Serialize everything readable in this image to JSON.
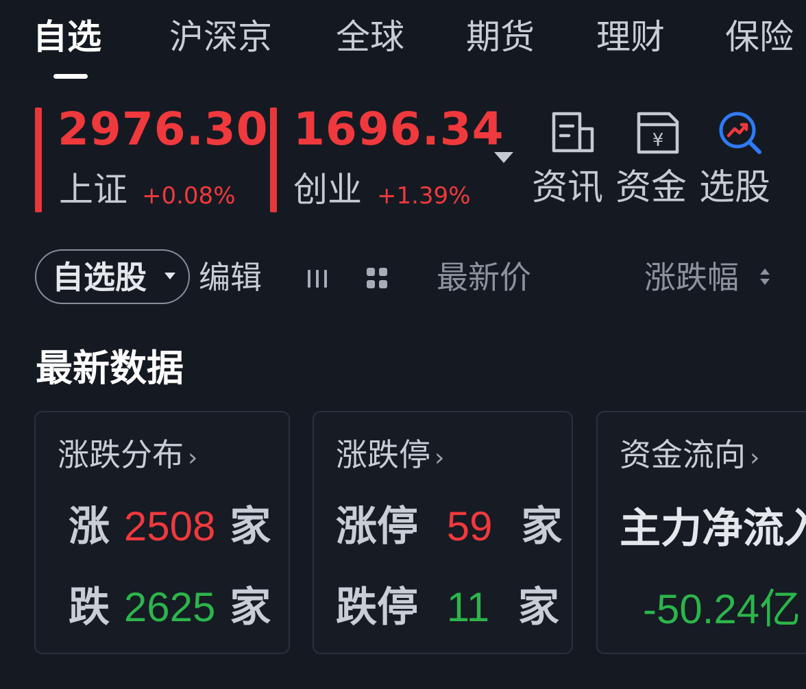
{
  "tabs": [
    {
      "label": "自选",
      "active": true
    },
    {
      "label": "沪深京"
    },
    {
      "label": "全球"
    },
    {
      "label": "期货"
    },
    {
      "label": "理财"
    },
    {
      "label": "保险"
    }
  ],
  "indices": [
    {
      "name": "上证",
      "value": "2976.30",
      "change": "+0.08%"
    },
    {
      "name": "创业",
      "value": "1696.34",
      "change": "+1.39%"
    }
  ],
  "tools": [
    {
      "label": "资讯",
      "icon": "news-document-icon"
    },
    {
      "label": "资金",
      "icon": "fund-yen-document-icon"
    },
    {
      "label": "选股",
      "icon": "stock-screener-icon"
    }
  ],
  "filter": {
    "watchlist_label": "自选股",
    "edit_label": "编辑",
    "latest_price_label": "最新价",
    "change_pct_label": "涨跌幅"
  },
  "section_title": "最新数据",
  "cards": {
    "distribution": {
      "title": "涨跌分布",
      "up_label": "涨",
      "up_count": "2508",
      "down_label": "跌",
      "down_count": "2625",
      "unit": "家"
    },
    "limit": {
      "title": "涨跌停",
      "up_label": "涨停",
      "up_count": "59",
      "down_label": "跌停",
      "down_count": "11",
      "unit": "家"
    },
    "flow": {
      "title": "资金流向",
      "label": "主力净流入",
      "value": "-50.24亿"
    }
  },
  "colors": {
    "background": "#151a22",
    "up": "#f0393d",
    "down": "#2cb54a",
    "accent_blue": "#2f7bf6"
  }
}
